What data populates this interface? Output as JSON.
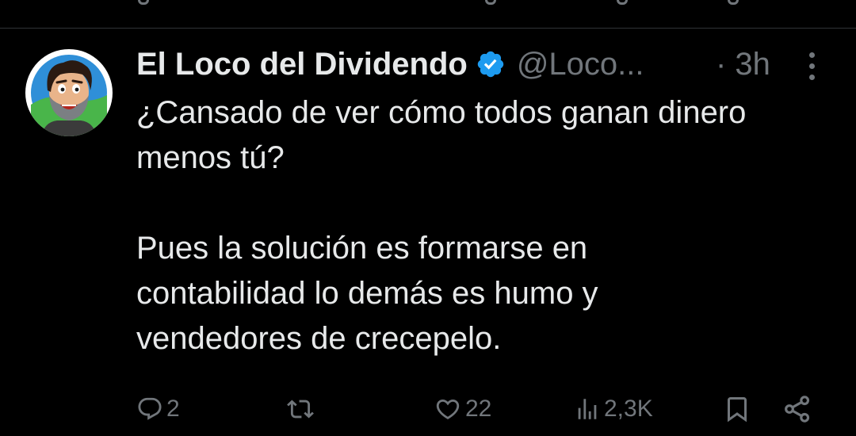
{
  "tweet": {
    "author_name": "El Loco del Dividendo",
    "author_handle": "@Loco...",
    "time": "· 3h",
    "paragraphs": [
      "¿Cansado de ver cómo todos ganan dinero\nmenos tú?",
      "Pues la solución es formarse en\ncontabilidad lo demás es humo y\nvendedores de crecepelo."
    ]
  },
  "actions": {
    "replies": "2",
    "retweets": "",
    "likes": "22",
    "views": "2,3K"
  },
  "colors": {
    "background": "#000000",
    "text": "#e7e9ea",
    "muted": "#71767b",
    "divider": "#2f3336",
    "verified": "#1d9bf0"
  },
  "icons": [
    "avatar",
    "verified-badge-icon",
    "more-options-icon",
    "reply-icon",
    "retweet-icon",
    "like-icon",
    "views-icon",
    "bookmark-icon",
    "share-icon"
  ]
}
